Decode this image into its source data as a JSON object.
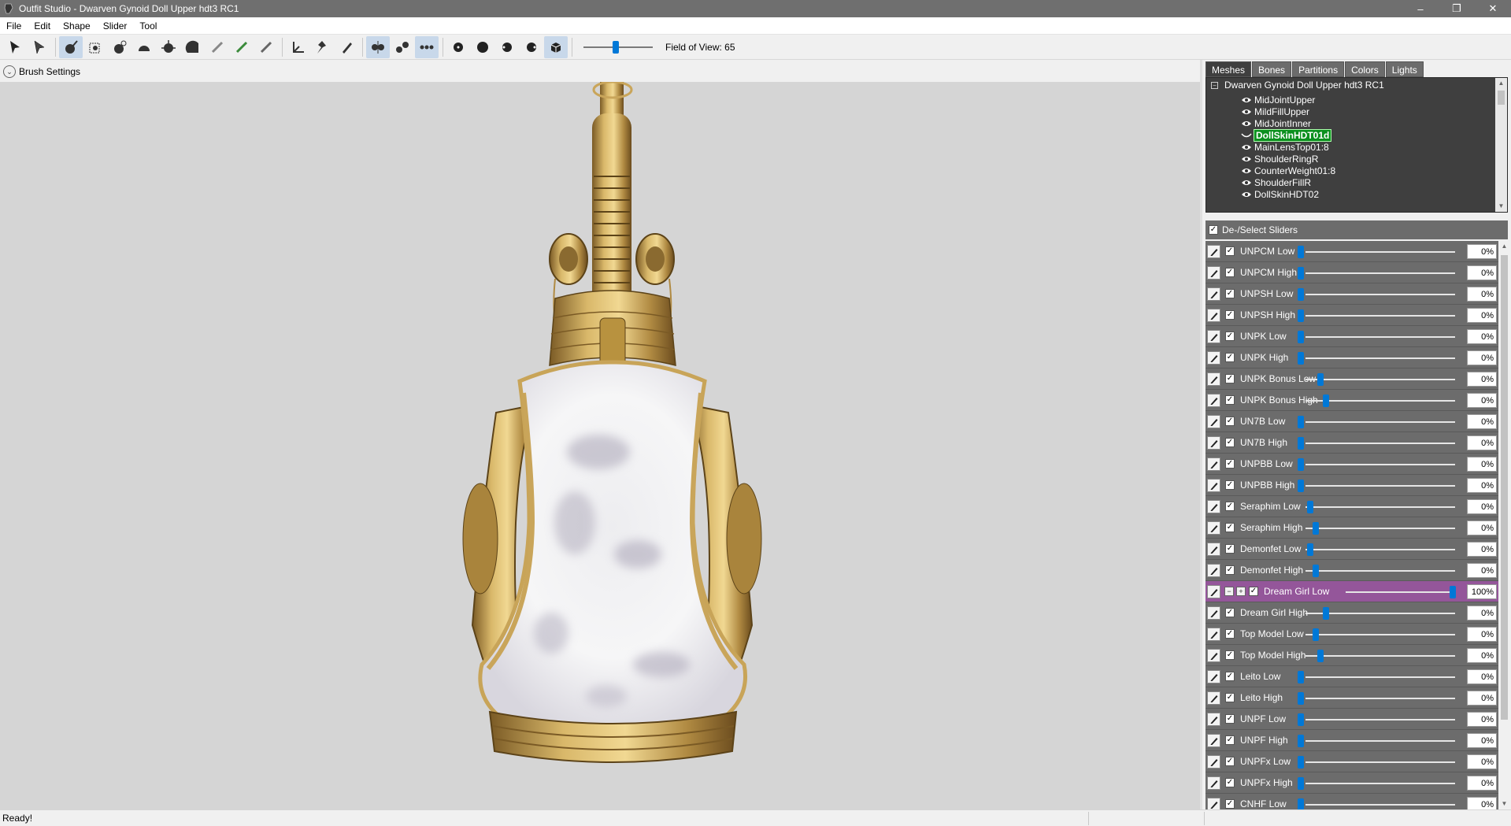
{
  "window": {
    "title": "Outfit Studio - Dwarven Gynoid Doll Upper hdt3 RC1",
    "controls": [
      "–",
      "❐",
      "✕"
    ]
  },
  "menu": [
    "File",
    "Edit",
    "Shape",
    "Slider",
    "Tool"
  ],
  "toolbar": {
    "fov_label": "Field of View: 65",
    "fov_value": 65
  },
  "brush_settings": {
    "label": "Brush Settings"
  },
  "panel": {
    "tabs": [
      "Meshes",
      "Bones",
      "Partitions",
      "Colors",
      "Lights"
    ],
    "tree_root": "Dwarven Gynoid Doll Upper hdt3 RC1",
    "meshes": [
      {
        "name": "MidJointUpper",
        "selected": false
      },
      {
        "name": "MildFillUpper",
        "selected": false
      },
      {
        "name": "MidJointInner",
        "selected": false
      },
      {
        "name": "DollSkinHDT01d",
        "selected": true
      },
      {
        "name": "MainLensTop01:8",
        "selected": false
      },
      {
        "name": "ShoulderRingR",
        "selected": false
      },
      {
        "name": "CounterWeight01:8",
        "selected": false
      },
      {
        "name": "ShoulderFillR",
        "selected": false
      },
      {
        "name": "DollSkinHDT02",
        "selected": false
      }
    ],
    "slider_header": "De-/Select Sliders"
  },
  "sliders": [
    {
      "name": "UNPCM Low",
      "value": "0%",
      "pos": 0.0,
      "active": false
    },
    {
      "name": "UNPCM High",
      "value": "0%",
      "pos": 0.0,
      "active": false
    },
    {
      "name": "UNPSH Low",
      "value": "0%",
      "pos": 0.0,
      "active": false
    },
    {
      "name": "UNPSH High",
      "value": "0%",
      "pos": 0.0,
      "active": false
    },
    {
      "name": "UNPK Low",
      "value": "0%",
      "pos": 0.0,
      "active": false
    },
    {
      "name": "UNPK High",
      "value": "0%",
      "pos": 0.0,
      "active": false
    },
    {
      "name": "UNPK Bonus Low",
      "value": "0%",
      "pos": 0.0,
      "active": false
    },
    {
      "name": "UNPK Bonus High",
      "value": "0%",
      "pos": 0.0,
      "active": false
    },
    {
      "name": "UN7B Low",
      "value": "0%",
      "pos": 0.0,
      "active": false
    },
    {
      "name": "UN7B High",
      "value": "0%",
      "pos": 0.0,
      "active": false
    },
    {
      "name": "UNPBB Low",
      "value": "0%",
      "pos": 0.0,
      "active": false
    },
    {
      "name": "UNPBB High",
      "value": "0%",
      "pos": 0.0,
      "active": false
    },
    {
      "name": "Seraphim Low",
      "value": "0%",
      "pos": 0.0,
      "active": false
    },
    {
      "name": "Seraphim High",
      "value": "0%",
      "pos": 0.0,
      "active": false
    },
    {
      "name": "Demonfet Low",
      "value": "0%",
      "pos": 0.0,
      "active": false
    },
    {
      "name": "Demonfet High",
      "value": "0%",
      "pos": 0.0,
      "active": false
    },
    {
      "name": "Dream Girl Low",
      "value": "100%",
      "pos": 1.0,
      "active": true
    },
    {
      "name": "Dream Girl High",
      "value": "0%",
      "pos": 0.0,
      "active": false
    },
    {
      "name": "Top Model Low",
      "value": "0%",
      "pos": 0.0,
      "active": false
    },
    {
      "name": "Top Model High",
      "value": "0%",
      "pos": 0.0,
      "active": false
    },
    {
      "name": "Leito Low",
      "value": "0%",
      "pos": 0.0,
      "active": false
    },
    {
      "name": "Leito High",
      "value": "0%",
      "pos": 0.0,
      "active": false
    },
    {
      "name": "UNPF Low",
      "value": "0%",
      "pos": 0.0,
      "active": false
    },
    {
      "name": "UNPF High",
      "value": "0%",
      "pos": 0.0,
      "active": false
    },
    {
      "name": "UNPFx Low",
      "value": "0%",
      "pos": 0.0,
      "active": false
    },
    {
      "name": "UNPFx High",
      "value": "0%",
      "pos": 0.0,
      "active": false
    },
    {
      "name": "CNHF Low",
      "value": "0%",
      "pos": 0.0,
      "active": false
    }
  ],
  "status": {
    "text": "Ready!"
  },
  "colors": {
    "accent": "#0078d7",
    "active_row": "#94569a",
    "row_bg": "#6c6c6c",
    "selected_mesh": "#0b8f1e",
    "viewport_bg": "#d5d5d5"
  }
}
